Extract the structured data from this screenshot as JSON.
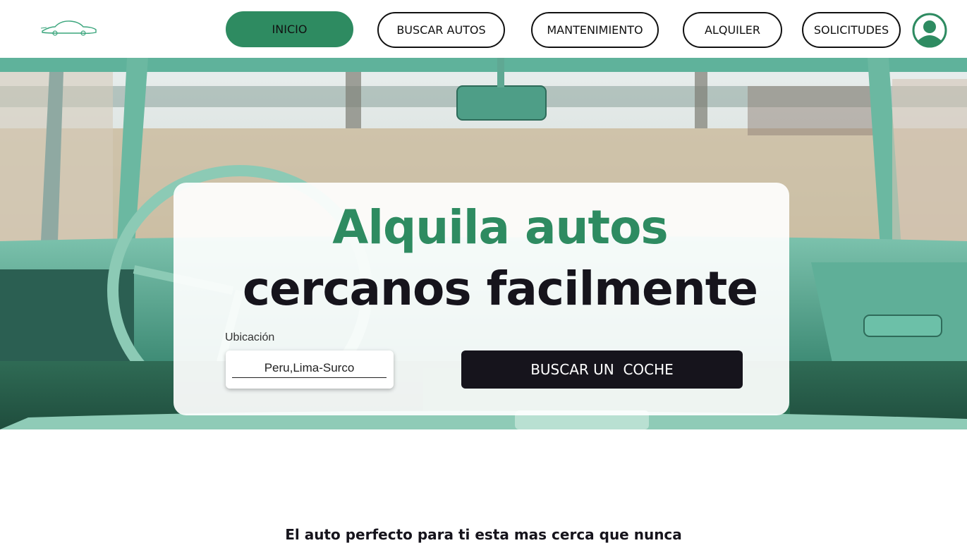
{
  "header": {
    "logo": "car-logo",
    "nav": [
      {
        "label": "INICIO",
        "active": true
      },
      {
        "label": "BUSCAR AUTOS",
        "active": false
      },
      {
        "label": "MANTENIMIENTO",
        "active": false
      },
      {
        "label": "ALQUILER",
        "active": false
      },
      {
        "label": "SOLICITUDES",
        "active": false
      }
    ],
    "avatar": "user-avatar-icon"
  },
  "hero": {
    "title_line1": "Alquila autos",
    "title_line2": "cercanos facilmente",
    "location_label": "Ubicación",
    "location_value": "Peru,Lima-Surco",
    "search_button": "BUSCAR UN  COCHE"
  },
  "section": {
    "tagline": "El auto perfecto para ti esta mas cerca que nunca"
  },
  "colors": {
    "accent": "#2e8b61",
    "dark": "#16141c",
    "teal_interior": "#6fb7a2"
  }
}
